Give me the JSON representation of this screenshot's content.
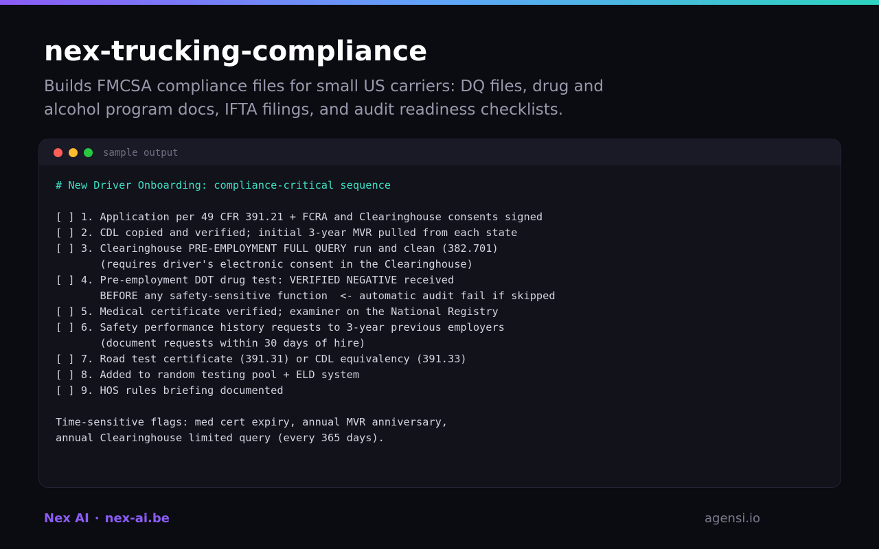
{
  "colors": {
    "background": "#0b0c11",
    "accent_purple": "#8b5cf6",
    "accent_teal": "#3fe0c5",
    "terminal_bg": "#11121a"
  },
  "header": {
    "title": "nex-trucking-compliance",
    "subtitle": "Builds FMCSA compliance files for small US carriers: DQ files, drug and alcohol program docs, IFTA filings, and audit readiness checklists."
  },
  "terminal": {
    "label": "sample output",
    "window_controls": [
      "close-dot",
      "minimize-dot",
      "maximize-dot"
    ],
    "heading": "# New Driver Onboarding: compliance-critical sequence",
    "lines": [
      "",
      "",
      "[ ] 1. Application per 49 CFR 391.21 + FCRA and Clearinghouse consents signed",
      "[ ] 2. CDL copied and verified; initial 3-year MVR pulled from each state",
      "[ ] 3. Clearinghouse PRE-EMPLOYMENT FULL QUERY run and clean (382.701)",
      "       (requires driver's electronic consent in the Clearinghouse)",
      "[ ] 4. Pre-employment DOT drug test: VERIFIED NEGATIVE received",
      "       BEFORE any safety-sensitive function  <- automatic audit fail if skipped",
      "[ ] 5. Medical certificate verified; examiner on the National Registry",
      "[ ] 6. Safety performance history requests to 3-year previous employers",
      "       (document requests within 30 days of hire)",
      "[ ] 7. Road test certificate (391.31) or CDL equivalency (391.33)",
      "[ ] 8. Added to random testing pool + ELD system",
      "[ ] 9. HOS rules briefing documented",
      "",
      "Time-sensitive flags: med cert expiry, annual MVR anniversary,",
      "annual Clearinghouse limited query (every 365 days)."
    ]
  },
  "footer": {
    "brand": "Nex AI",
    "separator": "·",
    "website": "nex-ai.be",
    "credit": "agensi.io"
  }
}
